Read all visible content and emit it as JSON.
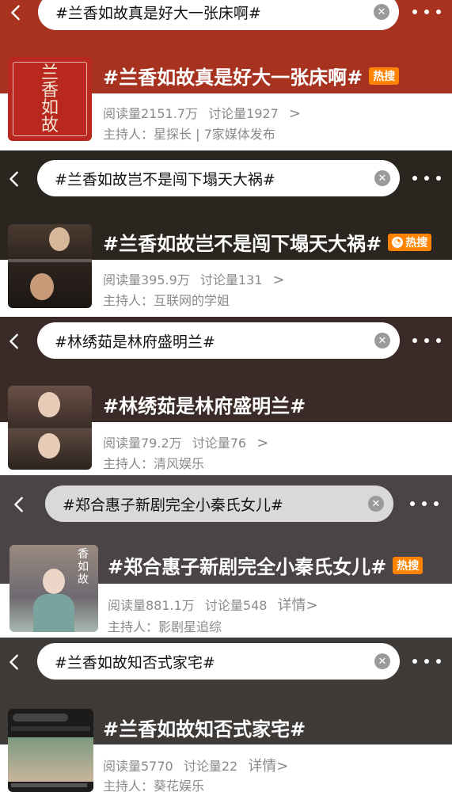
{
  "topics": [
    {
      "search": "#兰香如故真是好大一张床啊#",
      "title": "#兰香如故真是好大一张床啊#",
      "badge": "热搜",
      "read": "阅读量2151.7万",
      "discuss": "讨论量1927",
      "detail": ">",
      "host": "主持人：星探长 | 7家媒体发布",
      "thumb_text": "兰香如故",
      "bg": "#a6321f"
    },
    {
      "search": "#兰香如故岂不是闯下塌天大祸#",
      "title": "#兰香如故岂不是闯下塌天大祸#",
      "badge": "热搜",
      "read": "阅读量395.9万",
      "discuss": "讨论量131",
      "detail": ">",
      "host": "主持人：互联网的学姐",
      "thumb_text": "",
      "bg": "#2b2520"
    },
    {
      "search": "#林绣茹是林府盛明兰#",
      "title": "#林绣茹是林府盛明兰#",
      "badge": "",
      "read": "阅读量79.2万",
      "discuss": "讨论量76",
      "detail": ">",
      "host": "主持人：清风娱乐",
      "thumb_text": "",
      "bg": "#3a2a28"
    },
    {
      "search": "#郑合惠子新剧完全小秦氏女儿#",
      "title": "#郑合惠子新剧完全小秦氏女儿#",
      "badge": "热搜",
      "read": "阅读量881.1万",
      "discuss": "讨论量548",
      "detail": "详情>",
      "host": "主持人：影剧星追综",
      "thumb_text": "香如故",
      "bg": "#4a4446"
    },
    {
      "search": "#兰香如故知否式家宅#",
      "title": "#兰香如故知否式家宅#",
      "badge": "",
      "read": "阅读量5770",
      "discuss": "讨论量22",
      "detail": "详情>",
      "host": "主持人：葵花娱乐",
      "thumb_text": "",
      "bg": "#3e3a38"
    }
  ]
}
